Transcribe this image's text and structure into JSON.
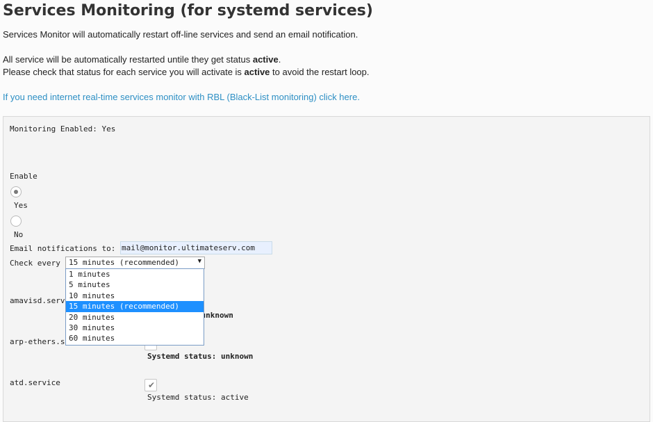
{
  "page": {
    "title": "Services Monitoring (for systemd services)",
    "intro_line1": "Services Monitor will automatically restart off-line services and send an email notification.",
    "intro_line2_pre": "All service will be automatically restarted untile they get status ",
    "intro_line2_bold": "active",
    "intro_line2_post": ".",
    "intro_line3_pre": "Please check that status for each service you will activate is ",
    "intro_line3_bold": "active",
    "intro_line3_post": " to avoid the restart loop.",
    "link_text": "If you need internet real-time services monitor with RBL (Black-List monitoring) click here."
  },
  "form": {
    "monitoring_enabled": "Monitoring Enabled: Yes",
    "enable_label": "Enable",
    "radio_yes": "Yes",
    "radio_no": "No",
    "enable_selected": "Yes",
    "email_label": "Email notifications to:",
    "email_value": "mail@monitor.ultimateserv.com",
    "check_every_label": "Check every",
    "check_every_value": "15 minutes (recommended)",
    "check_every_options": [
      "1 minutes",
      "5 minutes",
      "10 minutes",
      "15 minutes (recommended)",
      "20 minutes",
      "30 minutes",
      "60 minutes"
    ],
    "check_every_selected_index": 3
  },
  "services": [
    {
      "name": "amavisd.serv",
      "status_label": "Systemd status:",
      "status_value": "unknown",
      "status_visible": "us: unknown",
      "checked": false
    },
    {
      "name": "arp-ethers.s",
      "status_label": "Systemd status:",
      "status_value": "unknown",
      "checked": false
    },
    {
      "name": "atd.service",
      "status_label": "Systemd status:",
      "status_value": "active",
      "checked": true
    }
  ],
  "icons": {
    "dropdown_arrow": "chevron-down-icon",
    "checkmark": "checkmark-icon"
  },
  "colors": {
    "link": "#2d8fc4",
    "selected_option": "#1e90ff",
    "autofill_bg": "#e8f0fe"
  }
}
